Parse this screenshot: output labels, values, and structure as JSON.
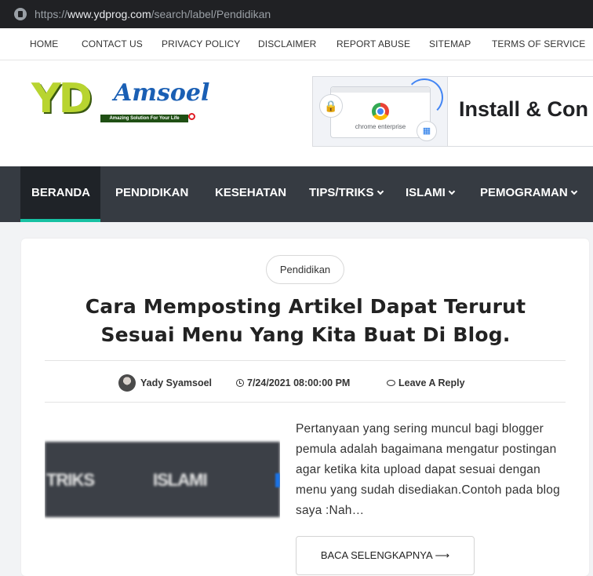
{
  "browser": {
    "url_scheme": "https://",
    "url_host": "www.ydprog.com",
    "url_path": "/search/label/Pendidikan"
  },
  "top_links": [
    "HOME",
    "CONTACT US",
    "PRIVACY POLICY",
    "DISCLAIMER",
    "REPORT ABUSE",
    "SITEMAP",
    "TERMS OF SERVICE"
  ],
  "logo": {
    "mark": "YD",
    "name": "Amsoel",
    "tagline": "Amazing Solution For Your Life"
  },
  "ad": {
    "product": "chrome enterprise",
    "headline": "Install & Con"
  },
  "main_nav": [
    {
      "label": "BERANDA",
      "active": true
    },
    {
      "label": "PENDIDIKAN"
    },
    {
      "label": "KESEHATAN"
    },
    {
      "label": "TIPS/TRIKS",
      "dropdown": true
    },
    {
      "label": "ISLAMI",
      "dropdown": true
    },
    {
      "label": "PEMOGRAMAN",
      "dropdown": true
    }
  ],
  "post": {
    "category": "Pendidikan",
    "title": "Cara Memposting Artikel Dapat Terurut Sesuai Menu Yang Kita Buat Di Blog.",
    "author": "Yady Syamsoel",
    "date": "7/24/2021 08:00:00 PM",
    "reply": "Leave A Reply",
    "thumb_text_1": "TRIKS",
    "thumb_text_2": "ISLAMI",
    "excerpt": "Pertanyaan yang sering muncul bagi blogger pemula adalah bagaimana mengatur postingan agar ketika kita upload dapat sesuai dengan menu yang sudah disediakan.Contoh pada blog saya :Nah…",
    "read_more": "BACA SELENGKAPNYA ⟶"
  },
  "colors": {
    "nav_bg": "#363b42",
    "nav_active": "#1f2328",
    "accent": "#17c1a3"
  }
}
